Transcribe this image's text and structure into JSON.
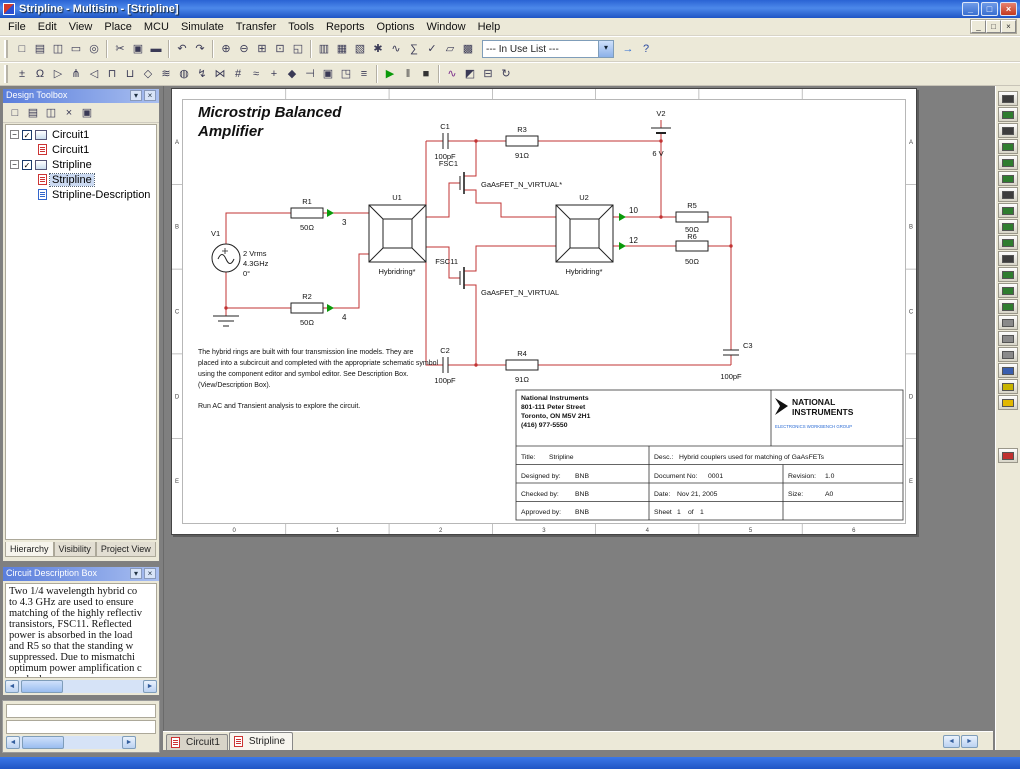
{
  "icons": {
    "arrow_left": "◄",
    "arrow_right": "►",
    "arrow_down": "▾",
    "close": "×",
    "pin": "▾",
    "minus": "−",
    "check": "✓"
  },
  "window": {
    "title": "Stripline - Multisim - [Stripline]",
    "min": "_",
    "restore": "□",
    "close": "×",
    "mdi_min": "_",
    "mdi_restore": "□",
    "mdi_close": "×"
  },
  "menu": {
    "items": [
      "File",
      "Edit",
      "View",
      "Place",
      "MCU",
      "Simulate",
      "Transfer",
      "Tools",
      "Reports",
      "Options",
      "Window",
      "Help"
    ]
  },
  "toolbar1": {
    "in_use_list": "--- In Use List ---",
    "groups": [
      [
        {
          "name": "new-file-icon",
          "glyph": "□"
        },
        {
          "name": "open-file-icon",
          "glyph": "▤"
        },
        {
          "name": "save-icon",
          "glyph": "◫"
        },
        {
          "name": "print-icon",
          "glyph": "▭"
        },
        {
          "name": "print-preview-icon",
          "glyph": "◎"
        }
      ],
      [
        {
          "name": "cut-icon",
          "glyph": "✂"
        },
        {
          "name": "copy-icon",
          "glyph": "▣"
        },
        {
          "name": "paste-icon",
          "glyph": "▬"
        }
      ],
      [
        {
          "name": "undo-icon",
          "glyph": "↶"
        },
        {
          "name": "redo-icon",
          "glyph": "↷"
        }
      ],
      [
        {
          "name": "zoom-in-icon",
          "glyph": "⊕"
        },
        {
          "name": "zoom-out-icon",
          "glyph": "⊖"
        },
        {
          "name": "zoom-window-icon",
          "glyph": "⊞"
        },
        {
          "name": "zoom-fit-icon",
          "glyph": "⊡"
        },
        {
          "name": "full-screen-icon",
          "glyph": "◱"
        }
      ],
      [
        {
          "name": "design-toolbox-toggle-icon",
          "glyph": "▥"
        },
        {
          "name": "spreadsheet-view-toggle-icon",
          "glyph": "▦"
        },
        {
          "name": "database-manager-icon",
          "glyph": "▧"
        },
        {
          "name": "create-component-icon",
          "glyph": "✱"
        },
        {
          "name": "grapher-icon",
          "glyph": "∿"
        },
        {
          "name": "postprocessor-icon",
          "glyph": "∑"
        },
        {
          "name": "electrical-rules-check-icon",
          "glyph": "✓"
        },
        {
          "name": "capture-screen-area-icon",
          "glyph": "▱"
        },
        {
          "name": "breadboard-view-icon",
          "glyph": "▩"
        }
      ]
    ],
    "after_groups": [
      [
        {
          "name": "education-web-page-icon",
          "glyph": "→",
          "color": "#2a6bd4"
        },
        {
          "name": "help-icon",
          "glyph": "?",
          "color": "#2a4aa0"
        }
      ]
    ]
  },
  "toolbar2": {
    "groups": [
      [
        {
          "name": "place-source-icon",
          "glyph": "±"
        },
        {
          "name": "place-basic-icon",
          "glyph": "Ω"
        },
        {
          "name": "place-diode-icon",
          "glyph": "▷"
        },
        {
          "name": "place-transistor-icon",
          "glyph": "⋔"
        },
        {
          "name": "place-analog-icon",
          "glyph": "◁"
        },
        {
          "name": "place-ttl-icon",
          "glyph": "⊓"
        },
        {
          "name": "place-cmos-icon",
          "glyph": "⊔"
        },
        {
          "name": "place-misc-digital-icon",
          "glyph": "◇"
        },
        {
          "name": "place-mixed-icon",
          "glyph": "≋"
        },
        {
          "name": "place-indicator-icon",
          "glyph": "◍"
        },
        {
          "name": "place-power-component-icon",
          "glyph": "↯"
        },
        {
          "name": "place-misc-component-icon",
          "glyph": "⋈"
        },
        {
          "name": "place-advanced-peripherals-icon",
          "glyph": "#"
        },
        {
          "name": "place-rf-icon",
          "glyph": "≈"
        },
        {
          "name": "place-electromechanical-icon",
          "glyph": "+"
        },
        {
          "name": "place-ni-component-icon",
          "glyph": "◆"
        },
        {
          "name": "place-connector-icon",
          "glyph": "⊣"
        },
        {
          "name": "place-mcu-icon",
          "glyph": "▣"
        },
        {
          "name": "place-hierarchical-block-icon",
          "glyph": "◳"
        },
        {
          "name": "place-bus-icon",
          "glyph": "≡"
        }
      ],
      [
        {
          "name": "run-simulation-button",
          "glyph": "▶",
          "color": "#0a9a0a"
        },
        {
          "name": "pause-simulation-button",
          "glyph": "‖",
          "color": "#444444"
        },
        {
          "name": "stop-simulation-button",
          "glyph": "■",
          "color": "#333333"
        }
      ],
      [
        {
          "name": "active-analysis-icon",
          "glyph": "∿",
          "color": "#7a2a8a"
        },
        {
          "name": "grapher-view-icon",
          "glyph": "◩"
        },
        {
          "name": "postprocessor-view-icon",
          "glyph": "⊟"
        },
        {
          "name": "refresh-icon",
          "glyph": "↻"
        }
      ]
    ]
  },
  "design_toolbox": {
    "title": "Design Toolbox",
    "toolbar_icons": [
      {
        "name": "new-schematic-icon",
        "glyph": "□"
      },
      {
        "name": "open-design-icon",
        "glyph": "▤"
      },
      {
        "name": "save-design-icon",
        "glyph": "◫"
      },
      {
        "name": "close-design-icon",
        "glyph": "×"
      },
      {
        "name": "rename-page-icon",
        "glyph": "▣"
      }
    ],
    "tree": [
      {
        "label": "Circuit1",
        "children": [
          {
            "label": "Circuit1",
            "kind": "sheet",
            "selected": false
          }
        ]
      },
      {
        "label": "Stripline",
        "children": [
          {
            "label": "Stripline",
            "kind": "sheet",
            "selected": true
          },
          {
            "label": "Stripline-Description",
            "kind": "desc",
            "selected": false
          }
        ]
      }
    ],
    "tabs": [
      "Hierarchy",
      "Visibility",
      "Project View"
    ]
  },
  "description_box": {
    "title": "Circuit Description Box",
    "lines": [
      "Two 1/4 wavelength hybrid co",
      "to 4.3 GHz are used to ensure",
      "matching of the highly reflectiv",
      "transistors, FSC11. Reflected",
      "power is absorbed in the load",
      "and R5 so that the standing w",
      "suppressed. Due to mismatchi",
      "optimum power amplification c",
      "reached."
    ]
  },
  "schematic": {
    "heading_line1": "Microstrip Balanced",
    "heading_line2": "Amplifier",
    "ruler_cols": [
      "0",
      "1",
      "2",
      "3",
      "4",
      "5",
      "6"
    ],
    "ruler_rows": [
      "A",
      "B",
      "C",
      "D",
      "E"
    ],
    "components": {
      "v1": {
        "ref": "V1",
        "l1": "2 Vrms",
        "l2": "4.3GHz",
        "l3": "0°"
      },
      "r1": {
        "ref": "R1",
        "val": "50Ω"
      },
      "r2": {
        "ref": "R2",
        "val": "50Ω"
      },
      "r3": {
        "ref": "R3",
        "val": "91Ω"
      },
      "r4": {
        "ref": "R4",
        "val": "91Ω"
      },
      "r5": {
        "ref": "R5",
        "val": "50Ω"
      },
      "r6": {
        "ref": "R6",
        "val": "50Ω"
      },
      "c1": {
        "ref": "C1",
        "val": "100pF"
      },
      "c2": {
        "ref": "C2",
        "val": "100pF"
      },
      "c3": {
        "ref": "C3",
        "val": "100pF"
      },
      "v2": {
        "ref": "V2",
        "val": "6 V"
      },
      "u1": {
        "ref": "U1",
        "val": "Hybridring*"
      },
      "u2": {
        "ref": "U2",
        "val": "Hybridring*"
      },
      "fsc1": {
        "ref": "FSC1",
        "val": "GaAsFET_N_VIRTUAL*"
      },
      "fsc11": {
        "ref": "FSC11",
        "val": "GaAsFET_N_VIRTUAL"
      }
    },
    "nodes": {
      "n3": "3",
      "n4": "4",
      "n10": "10",
      "n12": "12"
    },
    "notes": [
      "The hybrid rings are built with four transmission line models. They are",
      "placed into a subcircuit and completed with the appropriate schematic symbol",
      "using the component editor and symbol editor. See Description Box.",
      "(View/Description Box)."
    ],
    "note2": "Run AC and Transient analysis to explore the circuit."
  },
  "title_block": {
    "company": "National Instruments",
    "address1": "801-111 Peter Street",
    "address2": "Toronto, ON M5V 2H1",
    "phone": "(416) 977-5550",
    "logo_line1": "NATIONAL",
    "logo_line2": "INSTRUMENTS",
    "logo_sub": "ELECTRONICS WORKBENCH GROUP",
    "title_label": "Title:",
    "title_value": "Stripline",
    "desc_label": "Desc.:",
    "desc_value": "Hybrid couplers used for matching of GaAsFETs",
    "designed_label": "Designed by:",
    "designed_value": "BNB",
    "doc_label": "Document No:",
    "doc_value": "0001",
    "rev_label": "Revision:",
    "rev_value": "1.0",
    "checked_label": "Checked by:",
    "checked_value": "BNB",
    "date_label": "Date:",
    "date_value": "Nov 21, 2005",
    "size_label": "Size:",
    "size_value": "A0",
    "approved_label": "Approved by:",
    "approved_value": "BNB",
    "sheet_label": "Sheet",
    "sheet_value": "1",
    "of_label": "of",
    "of_value": "1"
  },
  "sheet_tabs": [
    {
      "label": "Circuit1",
      "active": false
    },
    {
      "label": "Stripline",
      "active": true
    }
  ],
  "instruments": [
    {
      "name": "multimeter-icon",
      "color": "#3d3d3d"
    },
    {
      "name": "function-generator-icon",
      "color": "#2f7d2f"
    },
    {
      "name": "wattmeter-icon",
      "color": "#3d3d3d"
    },
    {
      "name": "oscilloscope-icon",
      "color": "#2f7d2f"
    },
    {
      "name": "four-channel-oscilloscope-icon",
      "color": "#2f7d2f"
    },
    {
      "name": "bode-plotter-icon",
      "color": "#2f7d2f"
    },
    {
      "name": "frequency-counter-icon",
      "color": "#3d3d3d"
    },
    {
      "name": "word-generator-icon",
      "color": "#2f7d2f"
    },
    {
      "name": "logic-analyzer-icon",
      "color": "#2f7d2f"
    },
    {
      "name": "logic-converter-icon",
      "color": "#2f7d2f"
    },
    {
      "name": "iv-analyzer-icon",
      "color": "#3d3d3d"
    },
    {
      "name": "distortion-analyzer-icon",
      "color": "#2f7d2f"
    },
    {
      "name": "spectrum-analyzer-icon",
      "color": "#2f7d2f"
    },
    {
      "name": "network-analyzer-icon",
      "color": "#2f7d2f"
    },
    {
      "name": "agilent-function-generator-icon",
      "color": "#8a8a8a"
    },
    {
      "name": "agilent-multimeter-icon",
      "color": "#8a8a8a"
    },
    {
      "name": "agilent-oscilloscope-icon",
      "color": "#8a8a8a"
    },
    {
      "name": "tektronix-oscilloscope-icon",
      "color": "#3a5fae"
    },
    {
      "name": "measurement-probe-icon",
      "color": "#c8b400"
    },
    {
      "name": "labview-instruments-icon",
      "color": "#e2b800"
    },
    {
      "name": "current-probe-icon",
      "color": "#c03030",
      "gap": true
    }
  ]
}
